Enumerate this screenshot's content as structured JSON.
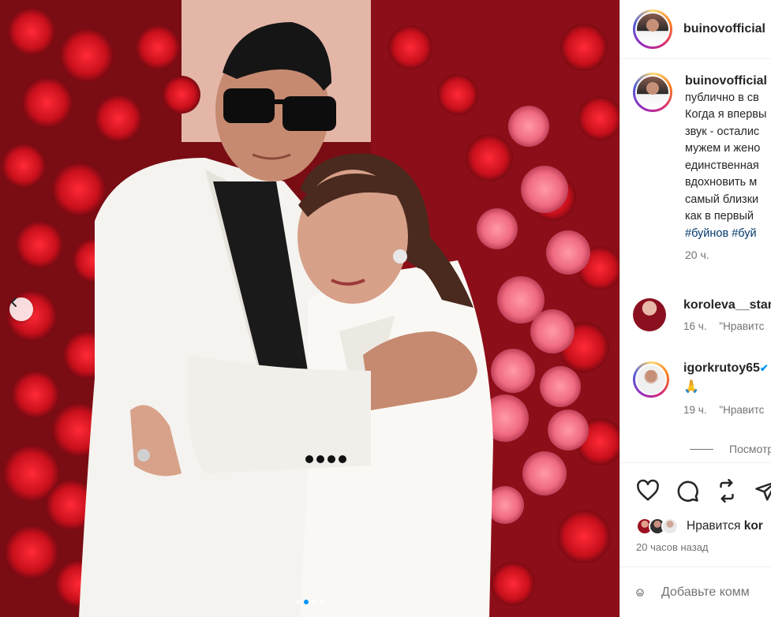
{
  "post": {
    "username": "buinovofficial",
    "media_alt": "Photo of a man and a woman in white suits embracing in front of a wall of red and pink roses"
  },
  "caption": {
    "username": "buinovofficial",
    "lines": [
      "публично в св",
      "Когда я впервы",
      "звук - осталис",
      "мужем и жено",
      "единственная",
      "вдохновить м",
      "самый близки",
      "как в первый"
    ],
    "hashtags": [
      "#буйнов",
      "#буй"
    ],
    "time": "20 ч."
  },
  "comments": [
    {
      "username": "koroleva__star",
      "text": "",
      "time": "16 ч.",
      "like_label": "\"Нравитс"
    },
    {
      "username": "igorkrutoy65",
      "verified": "✔",
      "text": "🙏",
      "time": "19 ч.",
      "like_label": "\"Нравитс"
    }
  ],
  "view_replies": "Посмотр",
  "icons": [
    "heart-icon",
    "comment-icon",
    "share-icon",
    "save-icon",
    "emoji-icon",
    "chevron-left-icon"
  ],
  "likes": {
    "prefix": "Нравится ",
    "user": "kor"
  },
  "posted_ago": "20 часов назад",
  "add_comment": {
    "placeholder": "Добавьте комм"
  },
  "carousel": {
    "total": 4,
    "active": 1
  },
  "colors": {
    "link": "#00376b",
    "accent": "#0095f6",
    "muted": "#737373"
  }
}
